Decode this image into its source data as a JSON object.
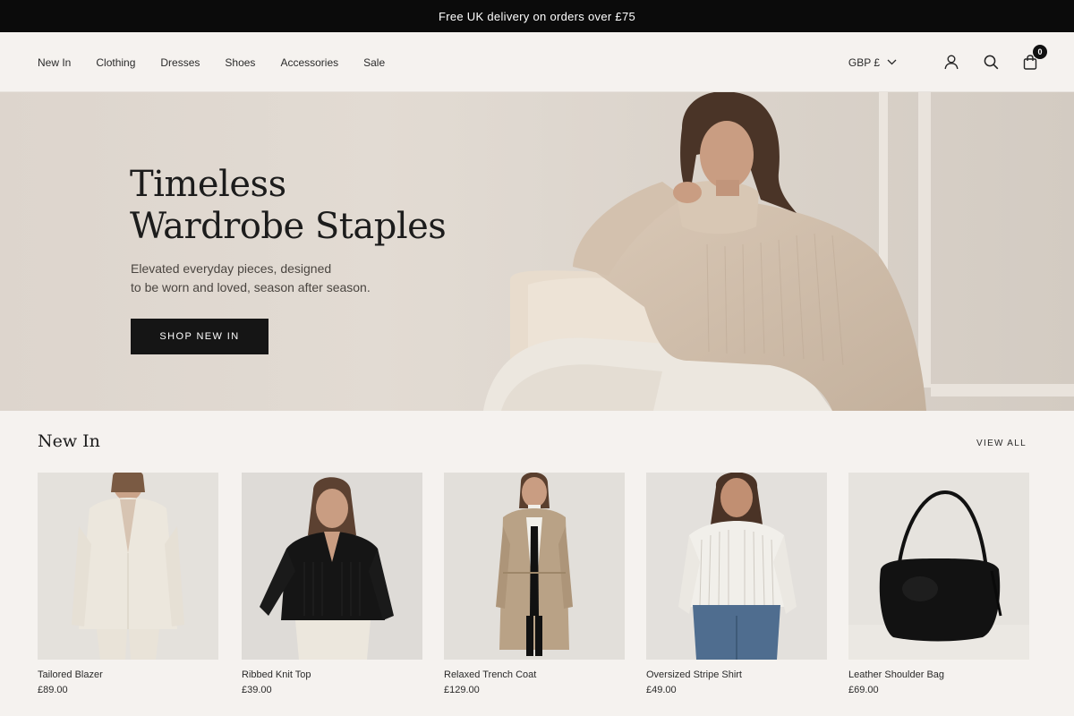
{
  "promo": {
    "text": "Free UK delivery on orders over £75"
  },
  "nav": {
    "items": [
      {
        "label": "New In"
      },
      {
        "label": "Clothing"
      },
      {
        "label": "Dresses"
      },
      {
        "label": "Shoes"
      },
      {
        "label": "Accessories"
      },
      {
        "label": "Sale"
      }
    ]
  },
  "header": {
    "currency": "GBP £",
    "cart_count": "0",
    "icons": [
      "account-icon",
      "search-icon",
      "shopping-bag-icon",
      "chevron-down-icon"
    ]
  },
  "hero": {
    "title_line1": "Timeless",
    "title_line2": "Wardrobe Staples",
    "subtitle_line1": "Elevated everyday pieces, designed",
    "subtitle_line2": "to be worn and loved, season after season.",
    "cta": "SHOP NEW IN"
  },
  "new_in": {
    "title": "New In",
    "view_all": "VIEW ALL",
    "products": [
      {
        "name": "Tailored Blazer",
        "price": "£89.00"
      },
      {
        "name": "Ribbed Knit Top",
        "price": "£39.00"
      },
      {
        "name": "Relaxed Trench Coat",
        "price": "£129.00"
      },
      {
        "name": "Oversized Stripe Shirt",
        "price": "£49.00"
      },
      {
        "name": "Leather Shoulder Bag",
        "price": "£69.00"
      }
    ]
  },
  "colors": {
    "promo_bg": "#0b0b0b",
    "page_bg": "#f5f2ef",
    "button_bg": "#151515",
    "hero_bg": "#ddd5cd"
  }
}
